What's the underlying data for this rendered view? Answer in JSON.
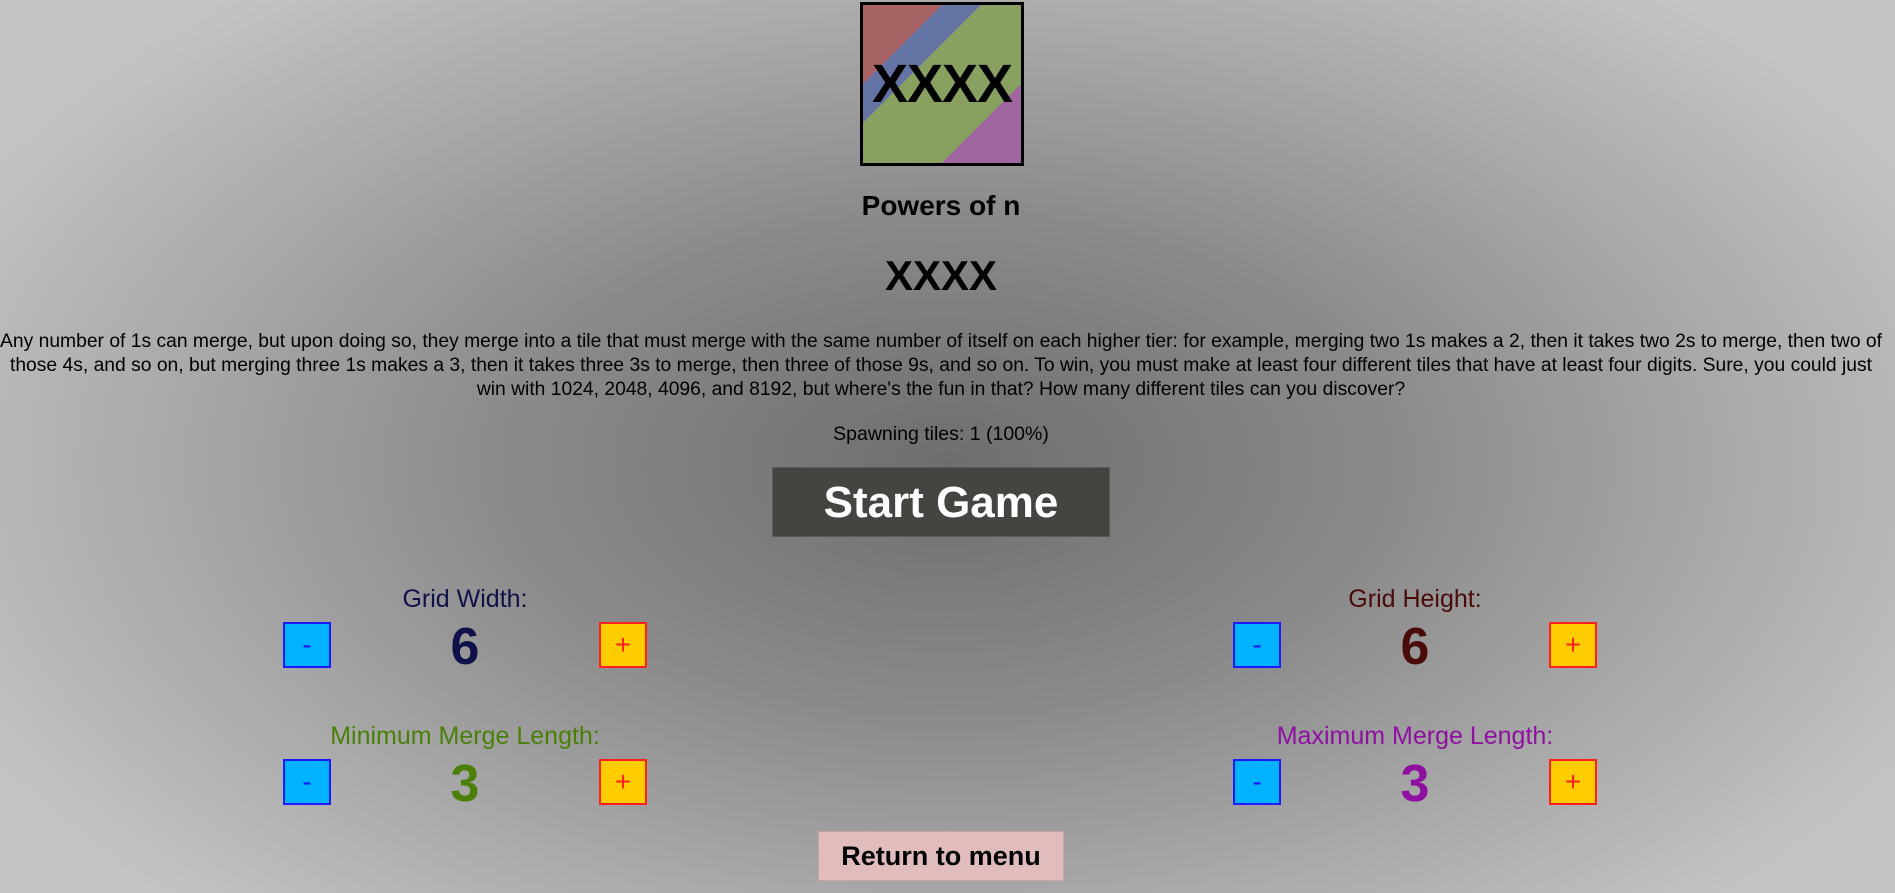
{
  "logo": {
    "text": "XXXX"
  },
  "subtitle": "Powers of n",
  "mode_title": "XXXX",
  "description": "Any number of 1s can merge, but upon doing so, they merge into a tile that must merge with the same number of itself on each higher tier: for example, merging two 1s makes a 2, then it takes two 2s to merge, then two of those 4s, and so on, but merging three 1s makes a 3, then it takes three 3s to merge, then three of those 9s, and so on. To win, you must make at least four different tiles that have at least four digits. Sure, you could just win with 1024, 2048, 4096, and 8192, but where's the fun in that? How many different tiles can you discover?",
  "spawn_text": "Spawning tiles: 1 (100%)",
  "start_label": "Start Game",
  "settings": {
    "grid_width": {
      "label": "Grid Width:",
      "value": "6",
      "color": "#10104a"
    },
    "grid_height": {
      "label": "Grid Height:",
      "value": "6",
      "color": "#4a0a0a"
    },
    "min_merge": {
      "label": "Minimum Merge Length:",
      "value": "3",
      "color": "#4a7f08"
    },
    "max_merge": {
      "label": "Maximum Merge Length:",
      "value": "3",
      "color": "#8f10a0"
    }
  },
  "controls": {
    "minus": "-",
    "plus": "+"
  },
  "return_label": "Return to menu"
}
